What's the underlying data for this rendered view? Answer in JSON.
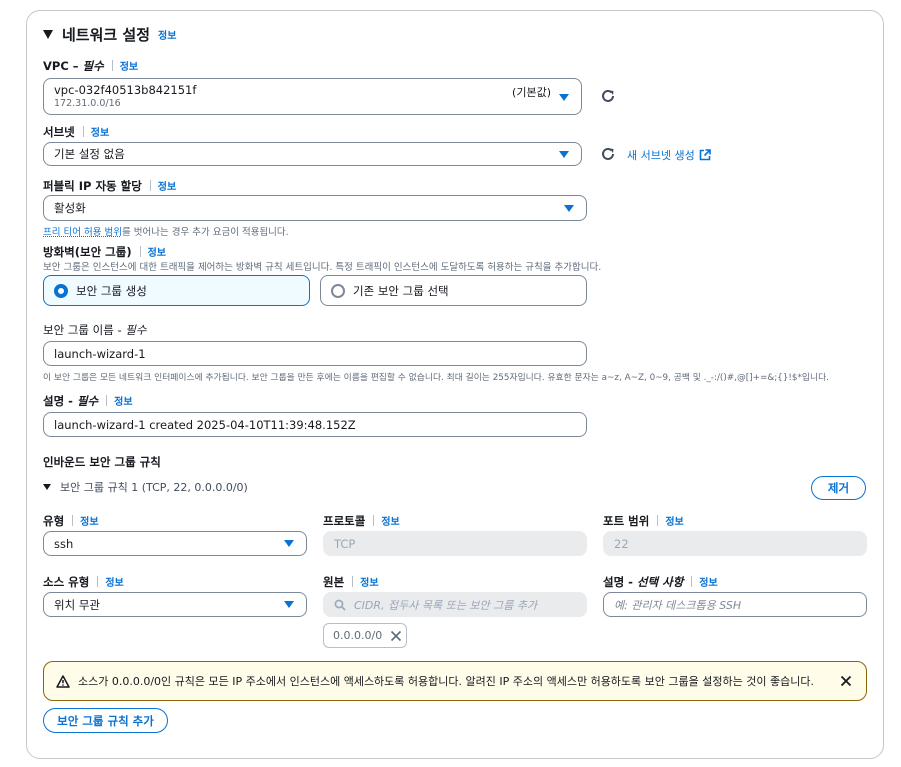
{
  "section": {
    "title": "네트워크 설정",
    "info": "정보"
  },
  "vpc": {
    "label": "VPC – ",
    "required": "필수",
    "info": "정보",
    "value": "vpc-032f40513b842151f",
    "cidr": "172.31.0.0/16",
    "tag": "(기본값)"
  },
  "subnet": {
    "label": "서브넷",
    "info": "정보",
    "value": "기본 설정 없음",
    "new_link": "새 서브넷 생성"
  },
  "public_ip": {
    "label": "퍼블릭 IP 자동 할당",
    "info": "정보",
    "value": "활성화",
    "note_link": "프리 티어 허용 범위",
    "note_rest": "를 벗어나는 경우 추가 요금이 적용됩니다."
  },
  "firewall": {
    "label": "방화벽(보안 그룹)",
    "info": "정보",
    "description": "보안 그룹은 인스턴스에 대한 트래픽을 제어하는 방화벽 규칙 세트입니다. 특정 트래픽이 인스턴스에 도달하도록 허용하는 규칙을 추가합니다.",
    "option_create": "보안 그룹 생성",
    "option_existing": "기존 보안 그룹 선택"
  },
  "sg_name": {
    "label": "보안 그룹 이름 - ",
    "required": "필수",
    "value": "launch-wizard-1",
    "hint": "이 보안 그룹은 모든 네트워크 인터페이스에 추가됩니다. 보안 그룹을 만든 후에는 이름을 편집할 수 없습니다. 최대 길이는 255자입니다. 유효한 문자는 a~z, A~Z, 0~9, 공백 및 ._-:/()#,@[]+=&;{}!$*입니다."
  },
  "description": {
    "label": "설명 - ",
    "required": "필수",
    "info": "정보",
    "value": "launch-wizard-1 created 2025-04-10T11:39:48.152Z"
  },
  "inbound": {
    "title": "인바운드 보안 그룹 규칙",
    "rule_title": "보안 그룹 규칙 1 (TCP, 22, 0.0.0.0/0)",
    "remove": "제거",
    "type_label": "유형",
    "type_value": "ssh",
    "protocol_label": "프로토콜",
    "protocol_value": "TCP",
    "port_label": "포트 범위",
    "port_value": "22",
    "source_type_label": "소스 유형",
    "source_type_value": "위치 무관",
    "source_label": "원본",
    "source_placeholder": "CIDR, 접두사 목록 또는 보안 그룹 추가",
    "source_token": "0.0.0.0/0",
    "desc_label": "설명 - ",
    "desc_optional": "선택 사항",
    "desc_placeholder": "예: 관리자 데스크톱용 SSH",
    "info": "정보"
  },
  "warning": {
    "text": "소스가 0.0.0.0/0인 규칙은 모든 IP 주소에서 인스턴스에 액세스하도록 허용합니다. 알려진 IP 주소의 액세스만 허용하도록 보안 그룹을 설정하는 것이 좋습니다."
  },
  "add_rule": "보안 그룹 규칙 추가",
  "colors": {
    "accent": "#0972d3",
    "warning_border": "#8d6605",
    "warning_bg": "#fffce9"
  }
}
